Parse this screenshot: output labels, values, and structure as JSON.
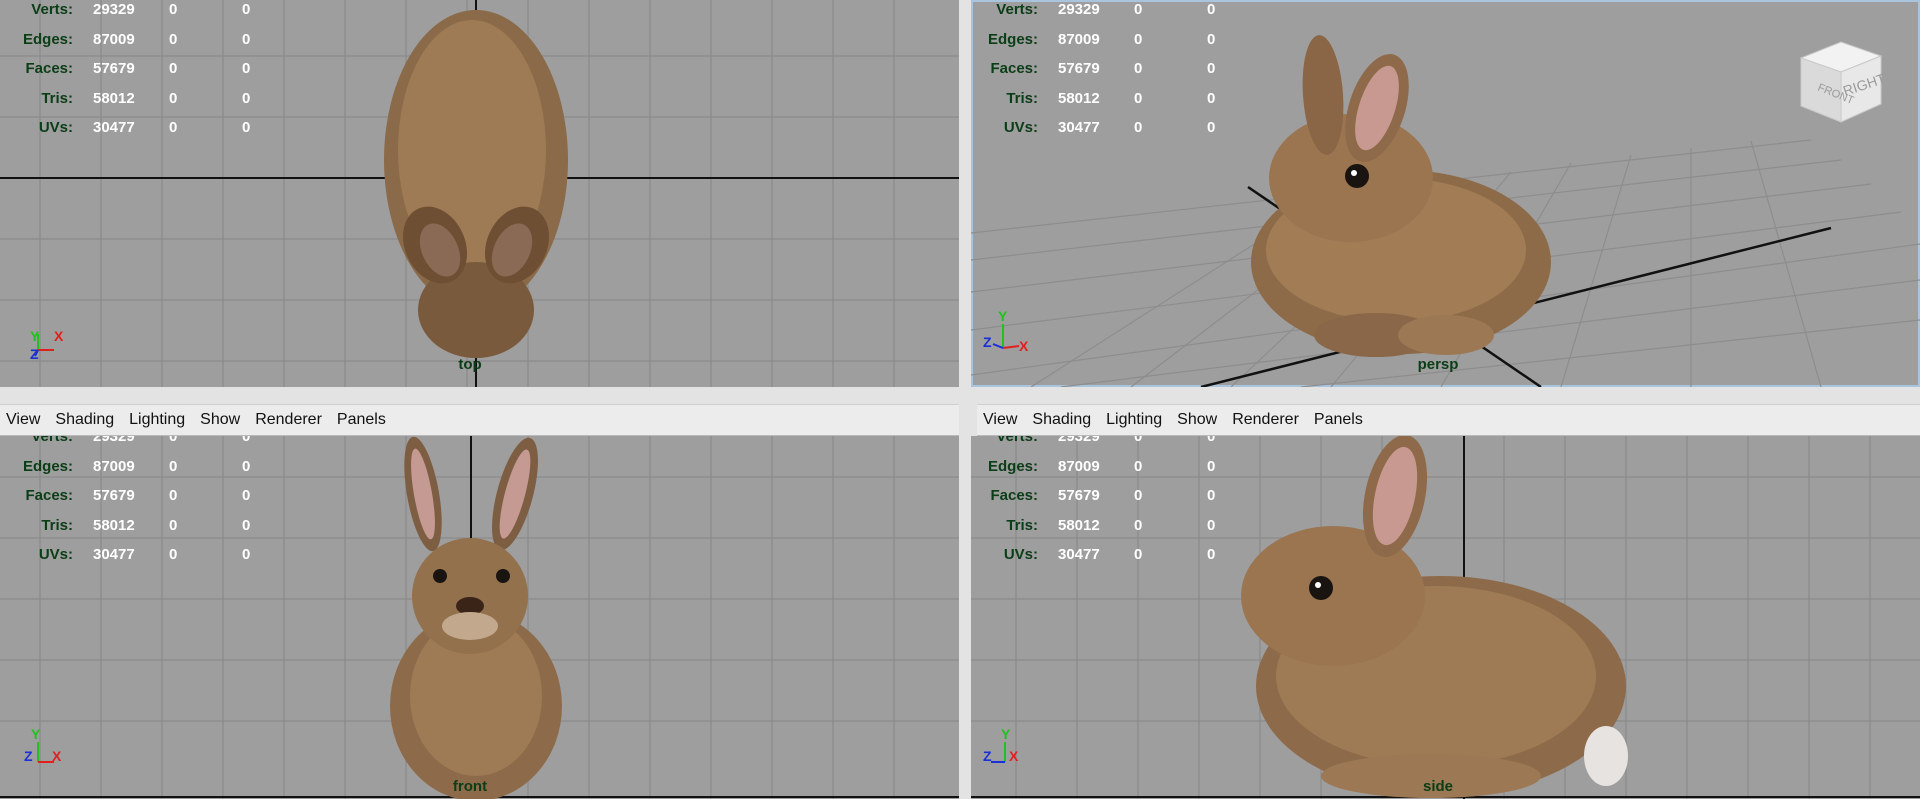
{
  "menu": [
    "View",
    "Shading",
    "Lighting",
    "Show",
    "Renderer",
    "Panels"
  ],
  "hud": {
    "labels": [
      "Verts:",
      "Edges:",
      "Faces:",
      "Tris:",
      "UVs:"
    ],
    "rows": [
      {
        "label": "Verts:",
        "total": "29329",
        "selected": "0",
        "selected2": "0"
      },
      {
        "label": "Edges:",
        "total": "87009",
        "selected": "0",
        "selected2": "0"
      },
      {
        "label": "Faces:",
        "total": "57679",
        "selected": "0",
        "selected2": "0"
      },
      {
        "label": "Tris:",
        "total": "58012",
        "selected": "0",
        "selected2": "0"
      },
      {
        "label": "UVs:",
        "total": "30477",
        "selected": "0",
        "selected2": "0"
      }
    ]
  },
  "viewports": {
    "top": {
      "camera": "top",
      "axes": [
        "Y",
        "X",
        "Z"
      ]
    },
    "persp": {
      "camera": "persp",
      "axes": [
        "Y",
        "Z",
        "X"
      ]
    },
    "front": {
      "camera": "front",
      "axes": [
        "Y",
        "Z",
        "X"
      ]
    },
    "side": {
      "camera": "side",
      "axes": [
        "Y",
        "Z",
        "X"
      ]
    }
  },
  "viewcube": {
    "face_right": "RIGHT",
    "face_front": "FRONT"
  },
  "colors": {
    "viewport_bg": "#9e9e9e",
    "grid": "#8a8a8a",
    "origin_line": "#111111",
    "hud_label": "#0b3d17",
    "hud_value": "#ffffff",
    "axis_x": "#e0201e",
    "axis_y": "#21c21f",
    "axis_z": "#1b2fd8",
    "active_border": "#a9c4dd"
  }
}
